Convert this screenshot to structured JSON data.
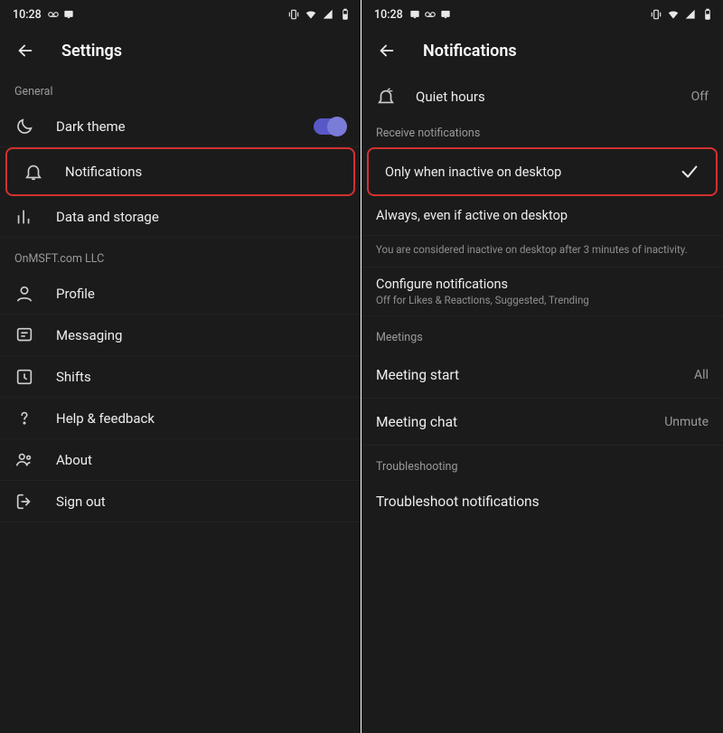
{
  "status": {
    "time": "10:28"
  },
  "left": {
    "title": "Settings",
    "section_general": "General",
    "dark_theme": "Dark theme",
    "notifications": "Notifications",
    "data_storage": "Data and storage",
    "section_org": "OnMSFT.com LLC",
    "profile": "Profile",
    "messaging": "Messaging",
    "shifts": "Shifts",
    "help": "Help & feedback",
    "about": "About",
    "signout": "Sign out"
  },
  "right": {
    "title": "Notifications",
    "quiet_hours": "Quiet hours",
    "quiet_hours_value": "Off",
    "section_receive": "Receive notifications",
    "opt_inactive": "Only when inactive on desktop",
    "opt_always": "Always, even if active on desktop",
    "inactive_desc": "You are considered inactive on desktop after 3 minutes of inactivity.",
    "config_title": "Configure notifications",
    "config_sub": "Off for Likes & Reactions, Suggested, Trending",
    "section_meetings": "Meetings",
    "meeting_start": "Meeting start",
    "meeting_start_value": "All",
    "meeting_chat": "Meeting chat",
    "meeting_chat_value": "Unmute",
    "section_trouble": "Troubleshooting",
    "troubleshoot": "Troubleshoot notifications"
  }
}
